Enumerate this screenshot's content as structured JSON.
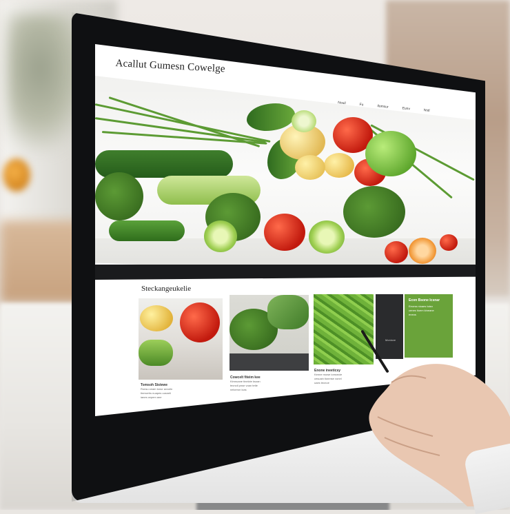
{
  "site": {
    "title": "Acallut Gumesn Cowelge",
    "nav": [
      "Nouil",
      "Fu",
      "Ilomsur",
      "Eunv",
      "Nstl"
    ]
  },
  "section": {
    "title": "Steckangeukelie"
  },
  "cards": [
    {
      "heading": "Tomsoh Sistewe",
      "lines": [
        "Ronsu ceam tonur avvoiln",
        "tinmcehs nuapes uosneli",
        "ianes cepem ane"
      ]
    },
    {
      "heading": "Cowcelt fiteim kee",
      "lines": [
        "Kimnuane tinelcte ksoan",
        "tecnoil pnse voan tetle",
        "nelceron lcas"
      ]
    },
    {
      "heading": "Enone ineeticsy",
      "lines": [
        "Kenne mowe iomcecie",
        "cesuain tionmse vonel",
        "uaes tecnoe"
      ]
    }
  ],
  "promo": {
    "heading": "Econ Bsone Icsnar",
    "lines": [
      "Eeorss nioaes toisn",
      "cenes tioem kineane",
      "eneos"
    ]
  },
  "dark_card": {
    "label": "Moniove"
  },
  "colors": {
    "accent_green": "#6aa33a",
    "bezel": "#0f1012",
    "screen": "#ffffff"
  }
}
